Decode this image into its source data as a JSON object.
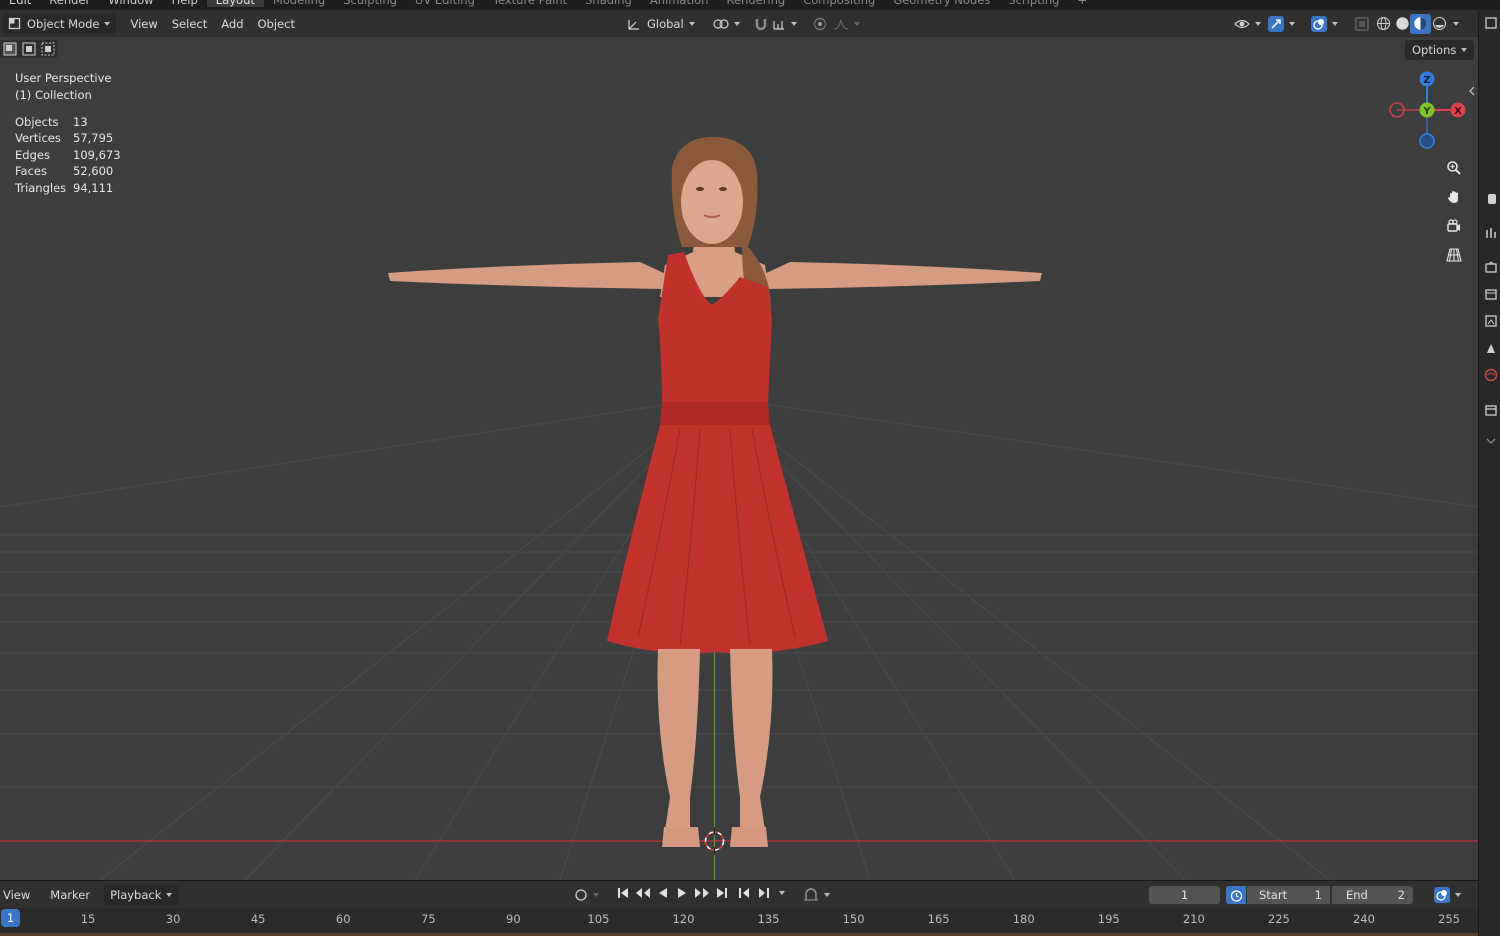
{
  "topbar": {
    "menu": [
      "Edit",
      "Render",
      "Window",
      "Help"
    ],
    "tabs": [
      "Layout",
      "Modeling",
      "Sculpting",
      "UV Editing",
      "Texture Paint",
      "Shading",
      "Animation",
      "Rendering",
      "Compositing",
      "Geometry Nodes",
      "Scripting",
      "+"
    ],
    "active_tab": "Layout"
  },
  "viewport_header": {
    "mode": "Object Mode",
    "menus": [
      "View",
      "Select",
      "Add",
      "Object"
    ],
    "orientation": "Global",
    "options_label": "Options"
  },
  "overlay": {
    "view_name": "User Perspective",
    "collection": "(1) Collection",
    "stats": [
      {
        "label": "Objects",
        "value": "13"
      },
      {
        "label": "Vertices",
        "value": "57,795"
      },
      {
        "label": "Edges",
        "value": "109,673"
      },
      {
        "label": "Faces",
        "value": "52,600"
      },
      {
        "label": "Triangles",
        "value": "94,111"
      }
    ]
  },
  "gizmo": {
    "z": "Z",
    "y": "Y",
    "x": "X"
  },
  "timeline": {
    "menus": [
      "View",
      "Marker",
      "Playback"
    ],
    "current_frame": "1",
    "start_label": "Start",
    "start_value": "1",
    "end_label": "End",
    "end_value": "2",
    "ruler_ticks": [
      "1",
      "15",
      "30",
      "45",
      "60",
      "75",
      "90",
      "105",
      "120",
      "135",
      "150",
      "165",
      "180",
      "195",
      "210",
      "225",
      "240",
      "255"
    ]
  },
  "colors": {
    "viewport_bg": "#3d3d3d",
    "header_bg": "#303030",
    "axis_x": "#e0414f",
    "axis_y": "#7ec628",
    "axis_z": "#2f7fe0",
    "accent": "#3b76c6",
    "dress": "#c0312b"
  }
}
